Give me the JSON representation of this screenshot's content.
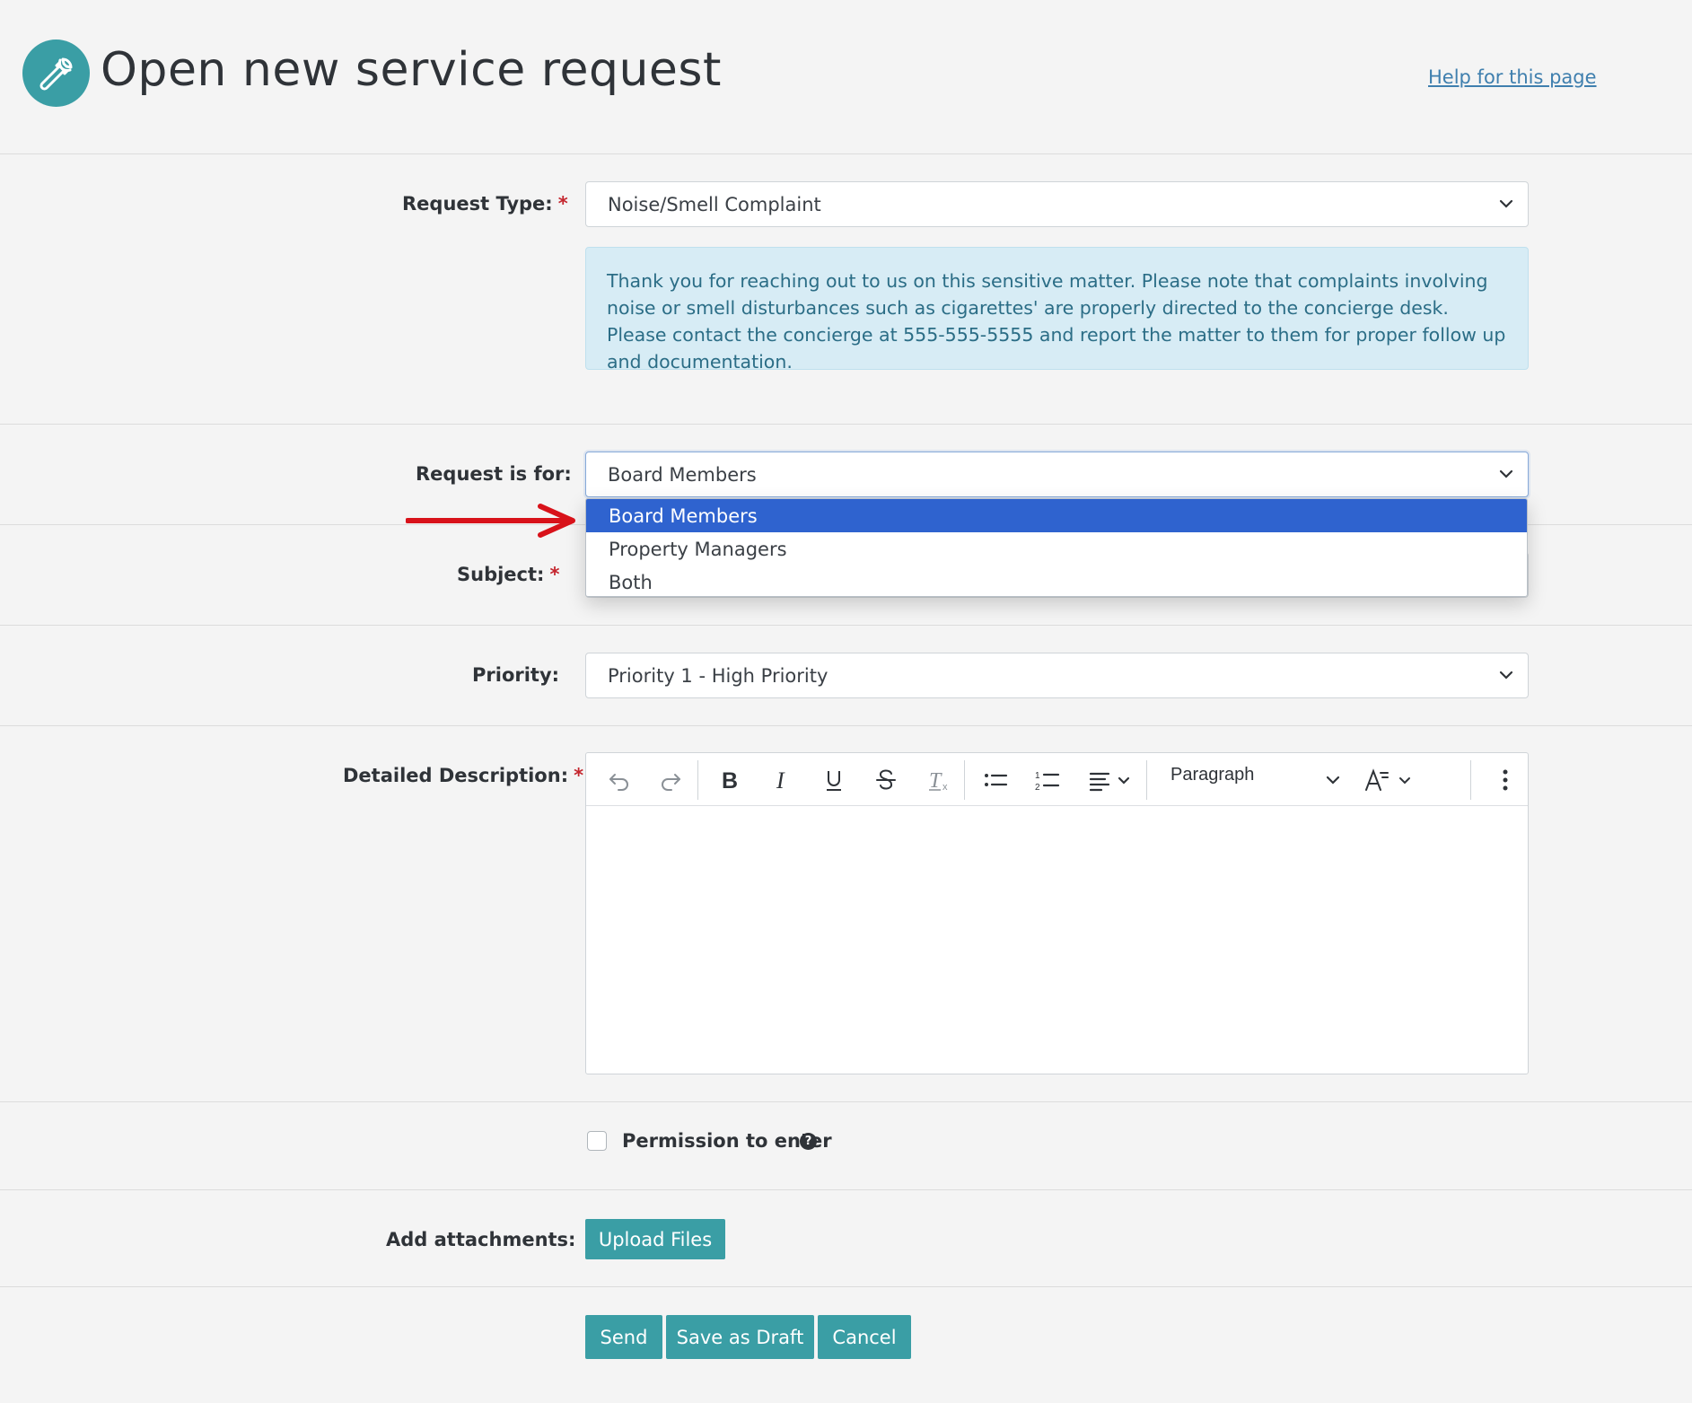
{
  "header": {
    "title": "Open new service request",
    "help_link": "Help for this page",
    "icon": "wrench-icon"
  },
  "form": {
    "request_type": {
      "label": "Request Type:",
      "required_mark": "*",
      "value": "Noise/Smell Complaint"
    },
    "info_message": "Thank you for reaching out to us on this sensitive matter. Please note that complaints involving noise or smell disturbances such as cigarettes' are properly directed to the concierge desk. Please contact the concierge at 555-555-5555 and report the matter to them for proper follow up and documentation.",
    "request_for": {
      "label": "Request is for:",
      "value": "Board Members",
      "options": [
        "Board Members",
        "Property Managers",
        "Both"
      ],
      "selected_index": 0
    },
    "subject": {
      "label": "Subject:",
      "required_mark": "*"
    },
    "priority": {
      "label": "Priority:",
      "value": "Priority 1 - High Priority"
    },
    "description": {
      "label": "Detailed Description:",
      "required_mark": "*",
      "toolbar": {
        "block_format": "Paragraph",
        "buttons": [
          "undo-icon",
          "redo-icon",
          "bold-icon",
          "italic-icon",
          "underline-icon",
          "strikethrough-icon",
          "clear-formatting-icon",
          "bullet-list-icon",
          "numbered-list-icon",
          "align-icon",
          "font-size-icon",
          "more-options-icon"
        ]
      }
    },
    "permission": {
      "label": "Permission to enter",
      "checked": false
    },
    "attachments": {
      "label": "Add attachments:",
      "button": "Upload Files"
    },
    "actions": {
      "send": "Send",
      "save_draft": "Save as Draft",
      "cancel": "Cancel"
    }
  },
  "colors": {
    "accent": "#3a9ea5",
    "selected_option": "#2f63cf",
    "required": "#c4262e",
    "info_bg": "#d7ecf5",
    "arrow": "#d8121a"
  }
}
